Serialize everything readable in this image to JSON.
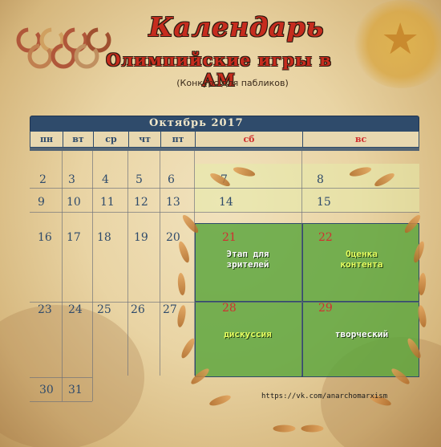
{
  "header": {
    "title": "Календарь",
    "subtitle": "Олимпийские игры в АМ",
    "note": "(Конкурс для пабликов)"
  },
  "calendar": {
    "month": "Октябрь 2017",
    "weekdays": [
      "пн",
      "вт",
      "ср",
      "чт",
      "пт",
      "сб",
      "вс"
    ],
    "weeks": [
      [
        "2",
        "3",
        "4",
        "5",
        "6",
        "7",
        "8"
      ],
      [
        "9",
        "10",
        "11",
        "12",
        "13",
        "14",
        "15"
      ],
      [
        "16",
        "17",
        "18",
        "19",
        "20",
        "21",
        "22"
      ],
      [
        "23",
        "24",
        "25",
        "26",
        "27",
        "28",
        "29"
      ],
      [
        "30",
        "31",
        "",
        "",
        "",
        "",
        ""
      ]
    ],
    "events": [
      {
        "date": "21",
        "text": "Этап для\nзрителей"
      },
      {
        "date": "22",
        "text": "Оценка\nконтента"
      },
      {
        "date": "28",
        "text": "дискуссия"
      },
      {
        "date": "29",
        "text": "творческий"
      }
    ]
  },
  "footer": {
    "link": "https://vk.com/anarchomarxism"
  },
  "colors": {
    "accent_red": "#c62c1e",
    "navy": "#2f4b6b",
    "green": "#5aa53c",
    "lime": "#e8ff60"
  },
  "decor": [
    "olympic-rings-icon",
    "laurel-wreath-icon",
    "star-emblem-icon"
  ]
}
